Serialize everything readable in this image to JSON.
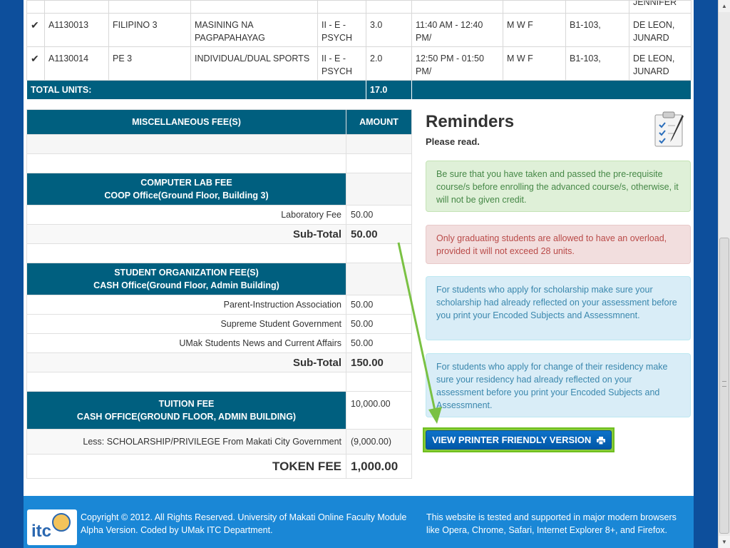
{
  "schedule": {
    "partial_row": {
      "instructor": "JENNIFER"
    },
    "rows": [
      {
        "code": "A1130013",
        "subject": "FILIPINO 3",
        "description": "MASINING NA PAGPAPAHAYAG",
        "section": "II - E - PSYCH",
        "units": "3.0",
        "time": "11:40 AM - 12:40 PM/",
        "days": "M W F",
        "room": "B1-103,",
        "instructor": "DE LEON, JUNARD"
      },
      {
        "code": "A1130014",
        "subject": "PE 3",
        "description": "INDIVIDUAL/DUAL SPORTS",
        "section": "II - E - PSYCH",
        "units": "2.0",
        "time": "12:50 PM - 01:50 PM/",
        "days": "M W F",
        "room": "B1-103,",
        "instructor": "DE LEON, JUNARD"
      }
    ],
    "total_label": "TOTAL UNITS:",
    "total_value": "17.0"
  },
  "fees": {
    "header_name": "MISCELLANEOUS FEE(S)",
    "header_amount": "AMOUNT",
    "computer_lab": {
      "title": "COMPUTER LAB FEE",
      "office": "COOP Office(Ground Floor, Building 3)",
      "items": [
        {
          "name": "Laboratory Fee",
          "amount": "50.00"
        }
      ],
      "subtotal_label": "Sub-Total",
      "subtotal": "50.00"
    },
    "student_org": {
      "title": "STUDENT ORGANIZATION FEE(S)",
      "office": "CASH Office(Ground Floor, Admin Building)",
      "items": [
        {
          "name": "Parent-Instruction Association",
          "amount": "50.00"
        },
        {
          "name": "Supreme Student Government",
          "amount": "50.00"
        },
        {
          "name": "UMak Students News and Current Affairs",
          "amount": "50.00"
        }
      ],
      "subtotal_label": "Sub-Total",
      "subtotal": "150.00"
    },
    "tuition": {
      "title": "TUITION FEE",
      "office": "CASH OFFICE(GROUND FLOOR, ADMIN BUILDING)",
      "amount": "10,000.00",
      "less_label": "Less: SCHOLARSHIP/PRIVILEGE From Makati City Government",
      "less_amount": "(9,000.00)"
    },
    "token_label": "TOKEN FEE",
    "token_amount": "1,000.00"
  },
  "reminders": {
    "title": "Reminders",
    "subtitle": "Please read.",
    "icon": "clipboard-icon",
    "alerts": [
      {
        "type": "success",
        "text": "Be sure that you have taken and passed the pre-requisite course/s before enrolling the advanced course/s, otherwise, it will not be given credit."
      },
      {
        "type": "error",
        "text": "Only graduating students are allowed to have an overload, provided it will not exceed 28 units."
      },
      {
        "type": "info",
        "text": "For students who apply for scholarship make sure your scholarship had already reflected on your assessment before you print your Encoded Subjects and Assessmnent."
      },
      {
        "type": "info",
        "text": "For students who apply for change of their residency make sure your residency had already reflected on your assessment before you print your Encoded Subjects and Assessmnent."
      }
    ]
  },
  "print_button": {
    "label": "VIEW PRINTER FRIENDLY VERSION",
    "icon": "printer-icon"
  },
  "footer": {
    "logo_text": "itc",
    "left_text": "Copyright © 2012. All Rights Reserved. University of Makati Online Faculty Module Alpha Version. Coded by UMak ITC Department.",
    "right_text": "This website is tested and supported in major modern browsers like Opera, Chrome, Safari, Internet Explorer 8+, and Firefox."
  },
  "colors": {
    "header_teal": "#005f7f",
    "page_blue": "#0d4f9c",
    "footer_blue": "#1a87d6",
    "arrow_green": "#7ac143"
  }
}
